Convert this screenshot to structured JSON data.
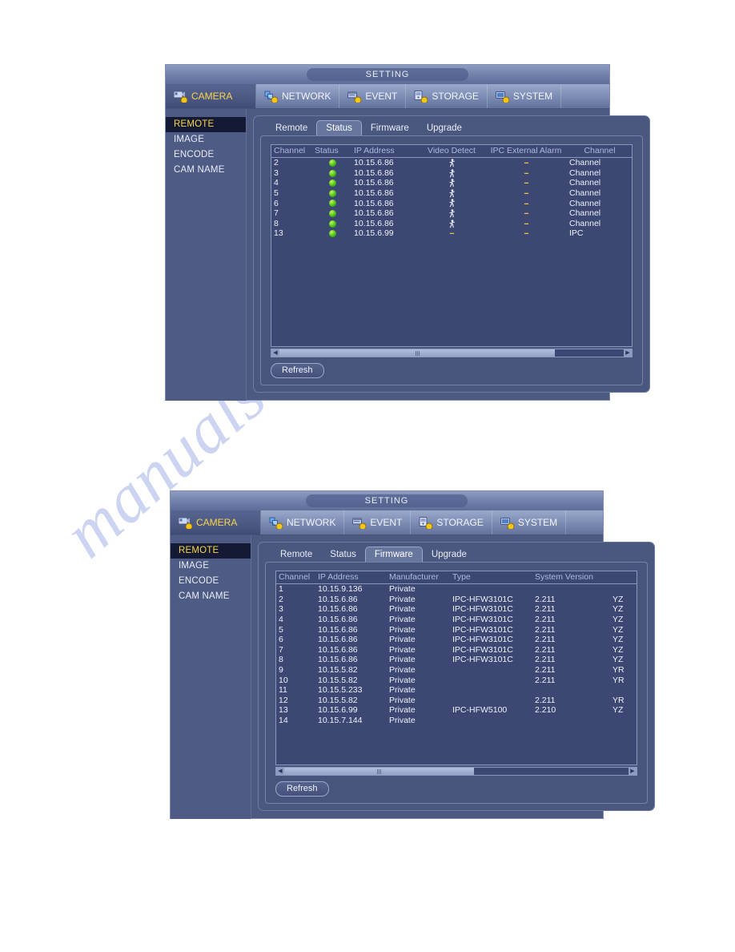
{
  "watermark": {
    "text": "manualsarchive.com"
  },
  "colors": {
    "accent_yellow": "#f8d44b",
    "status_green": "#3fbe12",
    "panel_blue": "#4a5880",
    "window_blue": "#4c5a82",
    "header_text": "#aeb9dd"
  },
  "panels": [
    {
      "title": "SETTING",
      "menu": [
        {
          "label": "CAMERA",
          "icon": "camera-icon",
          "active": true
        },
        {
          "label": "NETWORK",
          "icon": "network-icon",
          "active": false
        },
        {
          "label": "EVENT",
          "icon": "event-icon",
          "active": false
        },
        {
          "label": "STORAGE",
          "icon": "storage-icon",
          "active": false
        },
        {
          "label": "SYSTEM",
          "icon": "system-icon",
          "active": false
        }
      ],
      "sidebar": [
        {
          "label": "REMOTE",
          "active": true
        },
        {
          "label": "IMAGE",
          "active": false
        },
        {
          "label": "ENCODE",
          "active": false
        },
        {
          "label": "CAM NAME",
          "active": false
        }
      ],
      "tabs": [
        {
          "label": "Remote",
          "active": false
        },
        {
          "label": "Status",
          "active": true
        },
        {
          "label": "Firmware",
          "active": false
        },
        {
          "label": "Upgrade",
          "active": false
        }
      ],
      "table": {
        "headers": [
          "Channel",
          "Status",
          "IP Address",
          "Video Detect",
          "IPC External Alarm",
          "Channel"
        ],
        "rows": [
          {
            "channel": "2",
            "status": "online",
            "ip": "10.15.6.86",
            "video_detect": "motion",
            "ipc_alarm": "--",
            "channel_type": "Channel"
          },
          {
            "channel": "3",
            "status": "online",
            "ip": "10.15.6.86",
            "video_detect": "motion",
            "ipc_alarm": "--",
            "channel_type": "Channel"
          },
          {
            "channel": "4",
            "status": "online",
            "ip": "10.15.6.86",
            "video_detect": "motion",
            "ipc_alarm": "--",
            "channel_type": "Channel"
          },
          {
            "channel": "5",
            "status": "online",
            "ip": "10.15.6.86",
            "video_detect": "motion",
            "ipc_alarm": "--",
            "channel_type": "Channel"
          },
          {
            "channel": "6",
            "status": "online",
            "ip": "10.15.6.86",
            "video_detect": "motion",
            "ipc_alarm": "--",
            "channel_type": "Channel"
          },
          {
            "channel": "7",
            "status": "online",
            "ip": "10.15.6.86",
            "video_detect": "motion",
            "ipc_alarm": "--",
            "channel_type": "Channel"
          },
          {
            "channel": "8",
            "status": "online",
            "ip": "10.15.6.86",
            "video_detect": "motion",
            "ipc_alarm": "--",
            "channel_type": "Channel"
          },
          {
            "channel": "13",
            "status": "online",
            "ip": "10.15.6.99",
            "video_detect": "--",
            "ipc_alarm": "--",
            "channel_type": "IPC"
          }
        ]
      },
      "scrollbar": {
        "thumb_start_pct": 0,
        "thumb_width_pct": 80
      },
      "refresh_label": "Refresh"
    },
    {
      "title": "SETTING",
      "menu": [
        {
          "label": "CAMERA",
          "icon": "camera-icon",
          "active": true
        },
        {
          "label": "NETWORK",
          "icon": "network-icon",
          "active": false
        },
        {
          "label": "EVENT",
          "icon": "event-icon",
          "active": false
        },
        {
          "label": "STORAGE",
          "icon": "storage-icon",
          "active": false
        },
        {
          "label": "SYSTEM",
          "icon": "system-icon",
          "active": false
        }
      ],
      "sidebar": [
        {
          "label": "REMOTE",
          "active": true
        },
        {
          "label": "IMAGE",
          "active": false
        },
        {
          "label": "ENCODE",
          "active": false
        },
        {
          "label": "CAM NAME",
          "active": false
        }
      ],
      "tabs": [
        {
          "label": "Remote",
          "active": false
        },
        {
          "label": "Status",
          "active": false
        },
        {
          "label": "Firmware",
          "active": true
        },
        {
          "label": "Upgrade",
          "active": false
        }
      ],
      "table": {
        "headers": [
          "Channel",
          "IP Address",
          "Manufacturer",
          "Type",
          "System Version",
          ""
        ],
        "rows": [
          {
            "channel": "1",
            "ip": "10.15.9.136",
            "manufacturer": "Private",
            "type": "",
            "version": "",
            "extra": ""
          },
          {
            "channel": "2",
            "ip": "10.15.6.86",
            "manufacturer": "Private",
            "type": "IPC-HFW3101C",
            "version": "2.211",
            "extra": "YZ"
          },
          {
            "channel": "3",
            "ip": "10.15.6.86",
            "manufacturer": "Private",
            "type": "IPC-HFW3101C",
            "version": "2.211",
            "extra": "YZ"
          },
          {
            "channel": "4",
            "ip": "10.15.6.86",
            "manufacturer": "Private",
            "type": "IPC-HFW3101C",
            "version": "2.211",
            "extra": "YZ"
          },
          {
            "channel": "5",
            "ip": "10.15.6.86",
            "manufacturer": "Private",
            "type": "IPC-HFW3101C",
            "version": "2.211",
            "extra": "YZ"
          },
          {
            "channel": "6",
            "ip": "10.15.6.86",
            "manufacturer": "Private",
            "type": "IPC-HFW3101C",
            "version": "2.211",
            "extra": "YZ"
          },
          {
            "channel": "7",
            "ip": "10.15.6.86",
            "manufacturer": "Private",
            "type": "IPC-HFW3101C",
            "version": "2.211",
            "extra": "YZ"
          },
          {
            "channel": "8",
            "ip": "10.15.6.86",
            "manufacturer": "Private",
            "type": "IPC-HFW3101C",
            "version": "2.211",
            "extra": "YZ"
          },
          {
            "channel": "9",
            "ip": "10.15.5.82",
            "manufacturer": "Private",
            "type": "",
            "version": "2.211",
            "extra": "YR"
          },
          {
            "channel": "10",
            "ip": "10.15.5.82",
            "manufacturer": "Private",
            "type": "",
            "version": "2.211",
            "extra": "YR"
          },
          {
            "channel": "11",
            "ip": "10.15.5.233",
            "manufacturer": "Private",
            "type": "",
            "version": "",
            "extra": ""
          },
          {
            "channel": "12",
            "ip": "10.15.5.82",
            "manufacturer": "Private",
            "type": "",
            "version": "2.211",
            "extra": "YR"
          },
          {
            "channel": "13",
            "ip": "10.15.6.99",
            "manufacturer": "Private",
            "type": "IPC-HFW5100",
            "version": "2.210",
            "extra": "YZ"
          },
          {
            "channel": "14",
            "ip": "10.15.7.144",
            "manufacturer": "Private",
            "type": "",
            "version": "",
            "extra": ""
          }
        ]
      },
      "scrollbar": {
        "thumb_start_pct": 0,
        "thumb_width_pct": 55
      },
      "refresh_label": "Refresh"
    }
  ]
}
